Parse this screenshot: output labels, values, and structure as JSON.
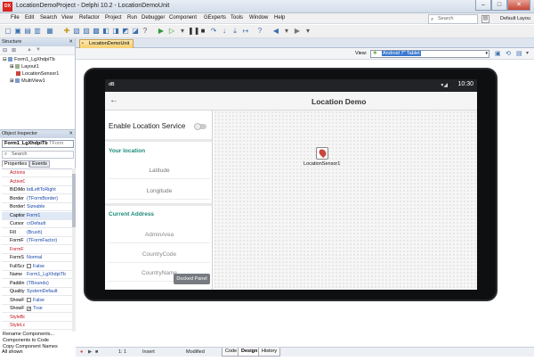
{
  "window": {
    "title": "LocationDemoProject - Delphi 10.2 - LocationDemoUnit",
    "minimize": "–",
    "maximize": "□",
    "close": "✕"
  },
  "menu": [
    "File",
    "Edit",
    "Search",
    "View",
    "Refactor",
    "Project",
    "Run",
    "Debugger",
    "Component",
    "GExperts",
    "Tools",
    "Window",
    "Help"
  ],
  "search": {
    "placeholder": "Search"
  },
  "layout": {
    "value": "Default Layou"
  },
  "structure": {
    "header": "Structure",
    "items": [
      "Form1_LgXhdpiTb",
      "Layout1",
      "LocationSensor1",
      "MultiView1"
    ]
  },
  "object_inspector": {
    "header": "Object Inspector",
    "selected": "Form1_LgXhdpiTb",
    "selected_type": "TForm",
    "search_placeholder": "Search",
    "tabs": [
      "Properties",
      "Events"
    ],
    "rows": [
      {
        "k": "Actions",
        "v": "",
        "red": true
      },
      {
        "k": "ActiveC",
        "v": "",
        "red": true
      },
      {
        "k": "BiDiMo",
        "v": "bdLeftToRight"
      },
      {
        "k": "Border",
        "v": "(TFormBorder)"
      },
      {
        "k": "BorderS",
        "v": "Sizeable"
      },
      {
        "k": "Caption",
        "v": "Form1",
        "sel": true
      },
      {
        "k": "Cursor",
        "v": "crDefault"
      },
      {
        "k": "Fill",
        "v": "(Brush)"
      },
      {
        "k": "FormF",
        "v": "(TFormFactor)"
      },
      {
        "k": "FormF",
        "v": "",
        "red": true
      },
      {
        "k": "FormS",
        "v": "Normal"
      },
      {
        "k": "FullScr",
        "v": "False",
        "chk": ""
      },
      {
        "k": "Name",
        "v": "Form1_LgXhdpiTb"
      },
      {
        "k": "Paddin",
        "v": "(TBounds)"
      },
      {
        "k": "Quality",
        "v": "SystemDefault"
      },
      {
        "k": "ShowF",
        "v": "False",
        "chk": ""
      },
      {
        "k": "ShowF",
        "v": "True",
        "chk": "✓"
      },
      {
        "k": "StyleBo",
        "v": "",
        "red": true
      },
      {
        "k": "StyleLo",
        "v": "",
        "red": true
      }
    ],
    "links": [
      "Rename Components...",
      "Components to Code",
      "Copy Component Names"
    ],
    "filter": "All shown"
  },
  "doc_tab": {
    "label": "LocationDemoUnit"
  },
  "view": {
    "label": "View:",
    "value": "Android 7\" Tablet",
    "dropdown": "▾"
  },
  "device": {
    "status_left": "dB",
    "signal": "▾◢",
    "time": "10:30"
  },
  "app": {
    "title": "Location Demo",
    "back": "←",
    "enable_label": "Enable Location Service",
    "section1": "Your location",
    "latitude": "Latitude",
    "longitude": "Longitude",
    "section2": "Current Address",
    "admin_area": "AdminArea",
    "country_code": "CountryCode",
    "country_name": "CountryName",
    "docked": "Docked Panel"
  },
  "sensor": {
    "label": "LocationSensor1"
  },
  "statusbar": {
    "position": "1: 1",
    "mode": "Insert",
    "state": "Modified",
    "tabs": [
      "Code",
      "Design",
      "History"
    ]
  },
  "colors": {
    "accent": "#1c8a7a",
    "tab_active": "#f5cf6c"
  }
}
